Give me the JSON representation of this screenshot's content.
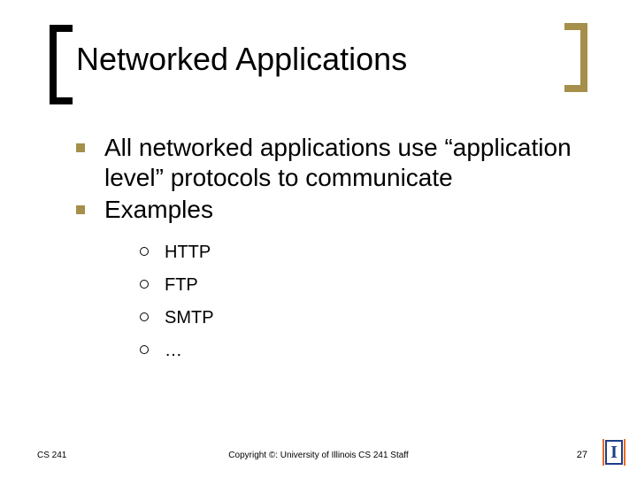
{
  "title": "Networked Applications",
  "bullets": [
    {
      "text": "All networked applications use “application level” protocols to communicate"
    },
    {
      "text": "Examples"
    }
  ],
  "sub_bullets": [
    {
      "text": "HTTP"
    },
    {
      "text": "FTP"
    },
    {
      "text": "SMTP"
    },
    {
      "text": "…"
    }
  ],
  "footer": {
    "left": "CS 241",
    "center": "Copyright ©: University of Illinois CS 241 Staff",
    "right": "27"
  },
  "logo_letter": "I"
}
